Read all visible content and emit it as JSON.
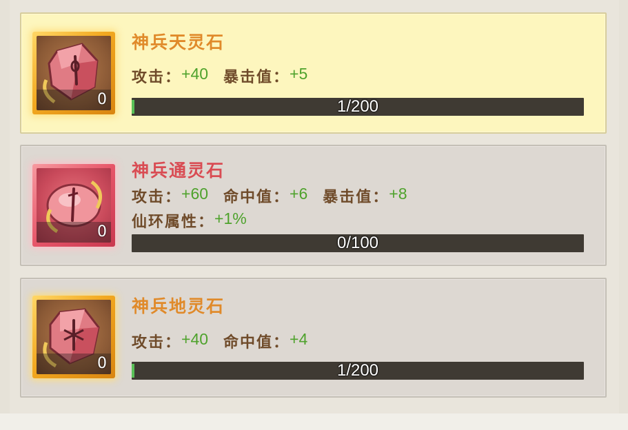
{
  "colors": {
    "name_orange": "#e08a2a",
    "name_red": "#d94c53",
    "stat_label": "#6f4b2a",
    "stat_value": "#4ea22c",
    "progress_bg": "#3f3a33",
    "progress_fill": "#59c057",
    "selected_card_bg": "#fdf6be",
    "card_bg": "#ddd8d2"
  },
  "items": [
    {
      "name": "神兵天灵石",
      "name_color": "#e08a2a",
      "icon": "spirit-stone-gold-icon",
      "count": "0",
      "selected": true,
      "stat_lines": [
        [
          {
            "label": "攻击：",
            "value": "+40"
          },
          {
            "label": "暴击值：",
            "value": "+5"
          }
        ]
      ],
      "progress_text": "1/200",
      "progress_ratio": 0.005
    },
    {
      "name": "神兵通灵石",
      "name_color": "#d94c53",
      "icon": "spirit-stone-pink-icon",
      "count": "0",
      "selected": false,
      "stat_lines": [
        [
          {
            "label": "攻击：",
            "value": "+60"
          },
          {
            "label": "命中值：",
            "value": "+6"
          },
          {
            "label": "暴击值：",
            "value": "+8"
          }
        ],
        [
          {
            "label": "仙环属性：",
            "value": "+1%"
          }
        ]
      ],
      "progress_text": "0/100",
      "progress_ratio": 0
    },
    {
      "name": "神兵地灵石",
      "name_color": "#e08a2a",
      "icon": "spirit-stone-gold-icon",
      "count": "0",
      "selected": false,
      "stat_lines": [
        [
          {
            "label": "攻击：",
            "value": "+40"
          },
          {
            "label": "命中值：",
            "value": "+4"
          }
        ]
      ],
      "progress_text": "1/200",
      "progress_ratio": 0.005
    }
  ]
}
